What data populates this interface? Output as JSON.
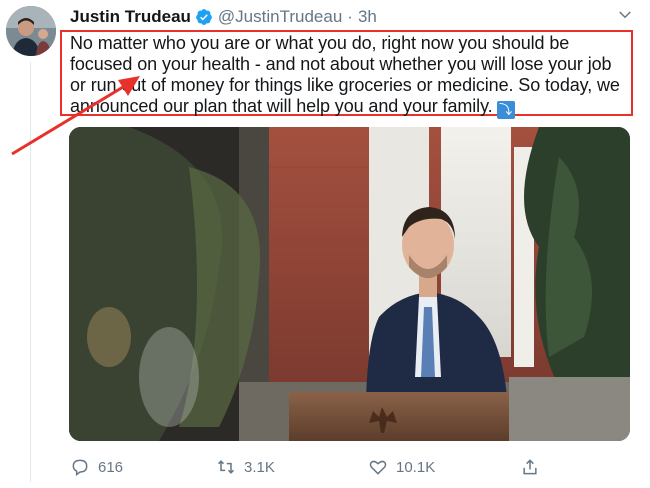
{
  "author": {
    "name": "Justin Trudeau",
    "handle": "@JustinTrudeau",
    "separator": "·",
    "time": "3h"
  },
  "tweet": {
    "lines": [
      "No matter who you are or what you do, right now you should be",
      "focused on your health - and not about whether you will lose your job",
      "or run out of money for things like groceries or medicine. So today, we",
      "announced our plan that will help you and your family."
    ],
    "emoji": "⤵"
  },
  "actions": {
    "replies": "616",
    "retweets": "3.1K",
    "likes": "10.1K"
  },
  "colors": {
    "highlight": "#e8312b",
    "verified": "#1da1f2",
    "muted": "#657786"
  },
  "icons": [
    "verified-icon",
    "chevron-down-icon",
    "reply-icon",
    "retweet-icon",
    "like-icon",
    "share-icon"
  ]
}
